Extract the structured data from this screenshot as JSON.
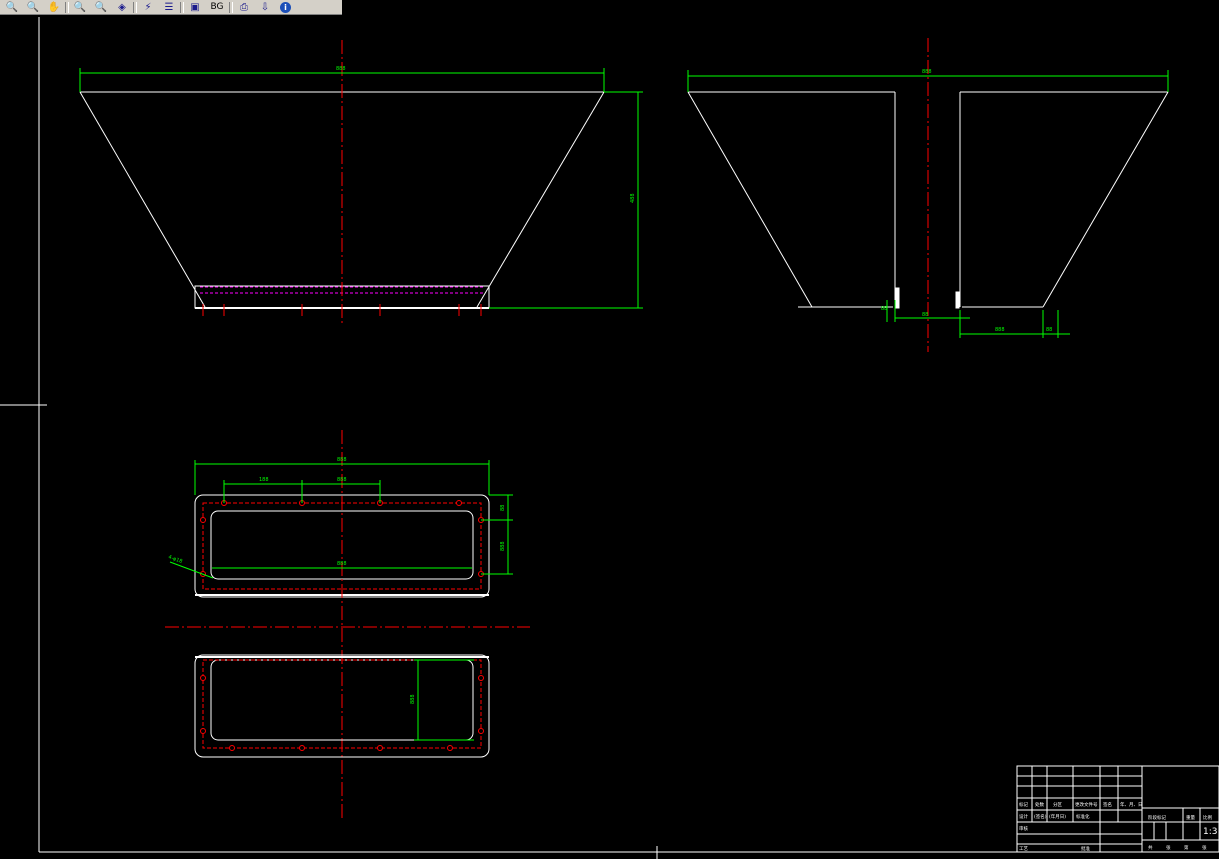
{
  "toolbar": {
    "buttons": [
      {
        "name": "zoom-realtime-icon",
        "glyph": "🔍"
      },
      {
        "name": "zoom-window-icon",
        "glyph": "🔍"
      },
      {
        "name": "pan-icon",
        "glyph": "✋"
      },
      {
        "name": "zoom-in-icon",
        "glyph": "🔍"
      },
      {
        "name": "zoom-out-icon",
        "glyph": "🔍"
      },
      {
        "name": "layer-icon",
        "glyph": "◈"
      },
      {
        "name": "lightning-icon",
        "glyph": "⚡"
      },
      {
        "name": "properties-icon",
        "glyph": "☰"
      },
      {
        "name": "save-icon",
        "glyph": "▣"
      },
      {
        "name": "bg-button",
        "glyph": "BG"
      },
      {
        "name": "printer-icon",
        "glyph": "⎙"
      },
      {
        "name": "export-icon",
        "glyph": "⇩"
      },
      {
        "name": "info-icon",
        "glyph": "i"
      }
    ]
  },
  "colors": {
    "background": "#000000",
    "outline": "#ffffff",
    "dimension": "#00ff00",
    "centerline": "#ff0000",
    "hidden": "#ff00ff"
  },
  "drawing": {
    "front_view": {
      "width_label": "888",
      "height_label": "488"
    },
    "side_view": {
      "width_label": "888",
      "gap_label": "88",
      "left_label": "88",
      "right_label": "888",
      "corner_label": "88"
    },
    "top_view": {
      "overall_label": "888",
      "hole_pitch_label": "188",
      "spacing_label": "888",
      "inner_label": "888",
      "edge_label": "88",
      "height_label": "888",
      "hole_note": "4-φ18"
    },
    "bottom_view": {
      "height_label": "888"
    }
  },
  "title_block": {
    "row1": [
      "标记",
      "处数",
      "分区",
      "更改文件号",
      "签名",
      "年、月、日"
    ],
    "row2": [
      "设计",
      "(签名)",
      "(年月日)",
      "标准化"
    ],
    "row3": [
      "审核"
    ],
    "row4": [
      "工艺",
      "批准"
    ],
    "stage_header": [
      "阶段标记",
      "重量",
      "比例"
    ],
    "scale": "1:3",
    "sheet": [
      "共",
      "张",
      "第",
      "张"
    ]
  }
}
